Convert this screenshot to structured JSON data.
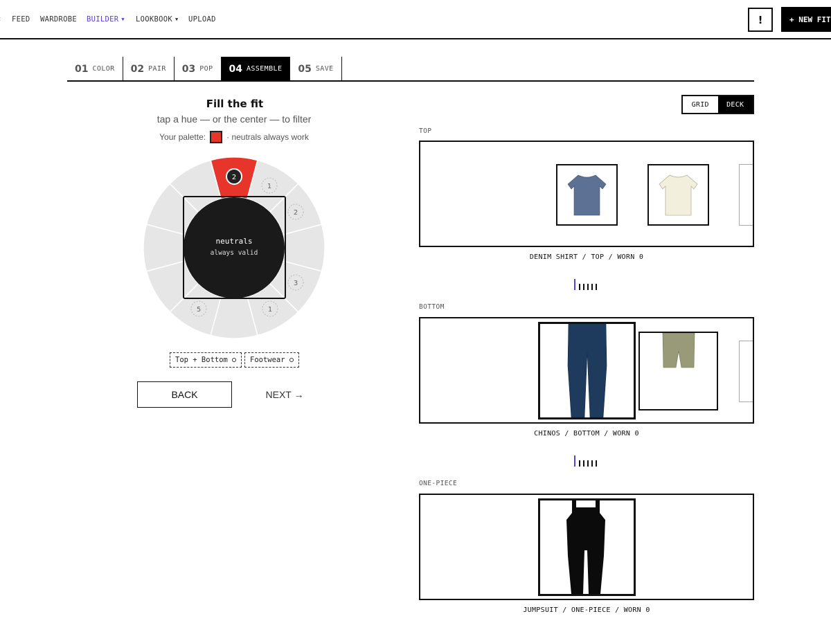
{
  "nav": {
    "edge_glyph": "‹",
    "items": [
      {
        "label": "FEED"
      },
      {
        "label": "WARDROBE"
      },
      {
        "label": "BUILDER",
        "caret": "▼"
      },
      {
        "label": "LOOKBOOK",
        "caret": "▼"
      },
      {
        "label": "UPLOAD"
      }
    ],
    "alert_label": "!",
    "new_fit_label": "+ NEW FIT"
  },
  "steps": [
    {
      "num": "01",
      "label": "COLOR"
    },
    {
      "num": "02",
      "label": "PAIR"
    },
    {
      "num": "03",
      "label": "POP"
    },
    {
      "num": "04",
      "label": "ASSEMBLE",
      "active": true
    },
    {
      "num": "05",
      "label": "SAVE"
    }
  ],
  "builder": {
    "title": "Fill the fit",
    "subtitle": "tap a hue — or the center — to filter",
    "palette_prefix": "Your palette:",
    "palette_suffix": "· neutrals always work",
    "palette_color": "#e8352b"
  },
  "wheel": {
    "selected_count": "2",
    "badges": [
      "1",
      "2",
      "3",
      "1",
      "5"
    ],
    "center_title": "neutrals",
    "center_sub": "always valid"
  },
  "chips": {
    "top_bottom": "Top + Bottom",
    "footwear": "Footwear"
  },
  "actions": {
    "back_label": "BACK",
    "next_label": "NEXT →"
  },
  "view_toggle": {
    "grid": "GRID",
    "deck": "DECK",
    "selected": "DECK"
  },
  "sections": {
    "top": {
      "label": "TOP",
      "caption": "DENIM SHIRT / TOP / WORN 0",
      "icons": [
        "tshirt-icon",
        "tshirt-icon"
      ],
      "colors": [
        "#5d7195",
        "#f2efdc"
      ]
    },
    "bottom": {
      "label": "BOTTOM",
      "caption": "CHINOS / BOTTOM / WORN 0",
      "icons": [
        "pants-icon",
        "shorts-icon"
      ],
      "colors": [
        "#1e3a5c",
        "#999b78"
      ]
    },
    "onepiece": {
      "label": "ONE-PIECE",
      "caption": "JUMPSUIT / ONE-PIECE / WORN 0",
      "icons": [
        "overalls-icon"
      ],
      "colors": [
        "#0b0b0b"
      ]
    }
  },
  "colors": {
    "accent": "#5b3fd1",
    "red": "#e8352b",
    "ink": "#111111",
    "wheel_gray": "#e6e6e6"
  }
}
